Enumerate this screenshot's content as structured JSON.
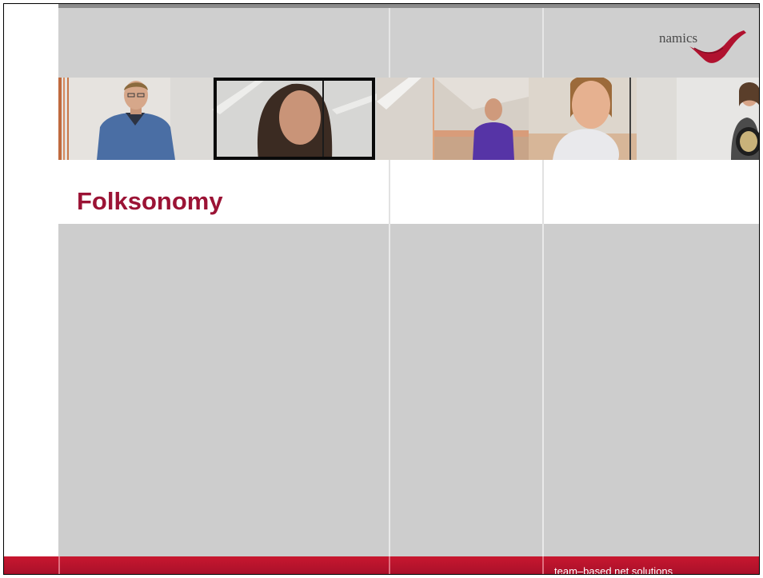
{
  "slide": {
    "title": "Folksonomy",
    "footer_tagline": "team–based net solutions"
  },
  "logo": {
    "text": "namics",
    "icon": "namics-swoosh-logo"
  },
  "photo_band": {
    "photos": [
      "man-in-blue-shirt-photo",
      "woman-portrait-photo",
      "man-in-purple-shirt-photo",
      "smiling-woman-photo",
      "woman-with-object-photo"
    ]
  },
  "colors": {
    "accent": "#9b1335",
    "footer": "#c8172f",
    "panel_gray": "#cdcdcd"
  }
}
